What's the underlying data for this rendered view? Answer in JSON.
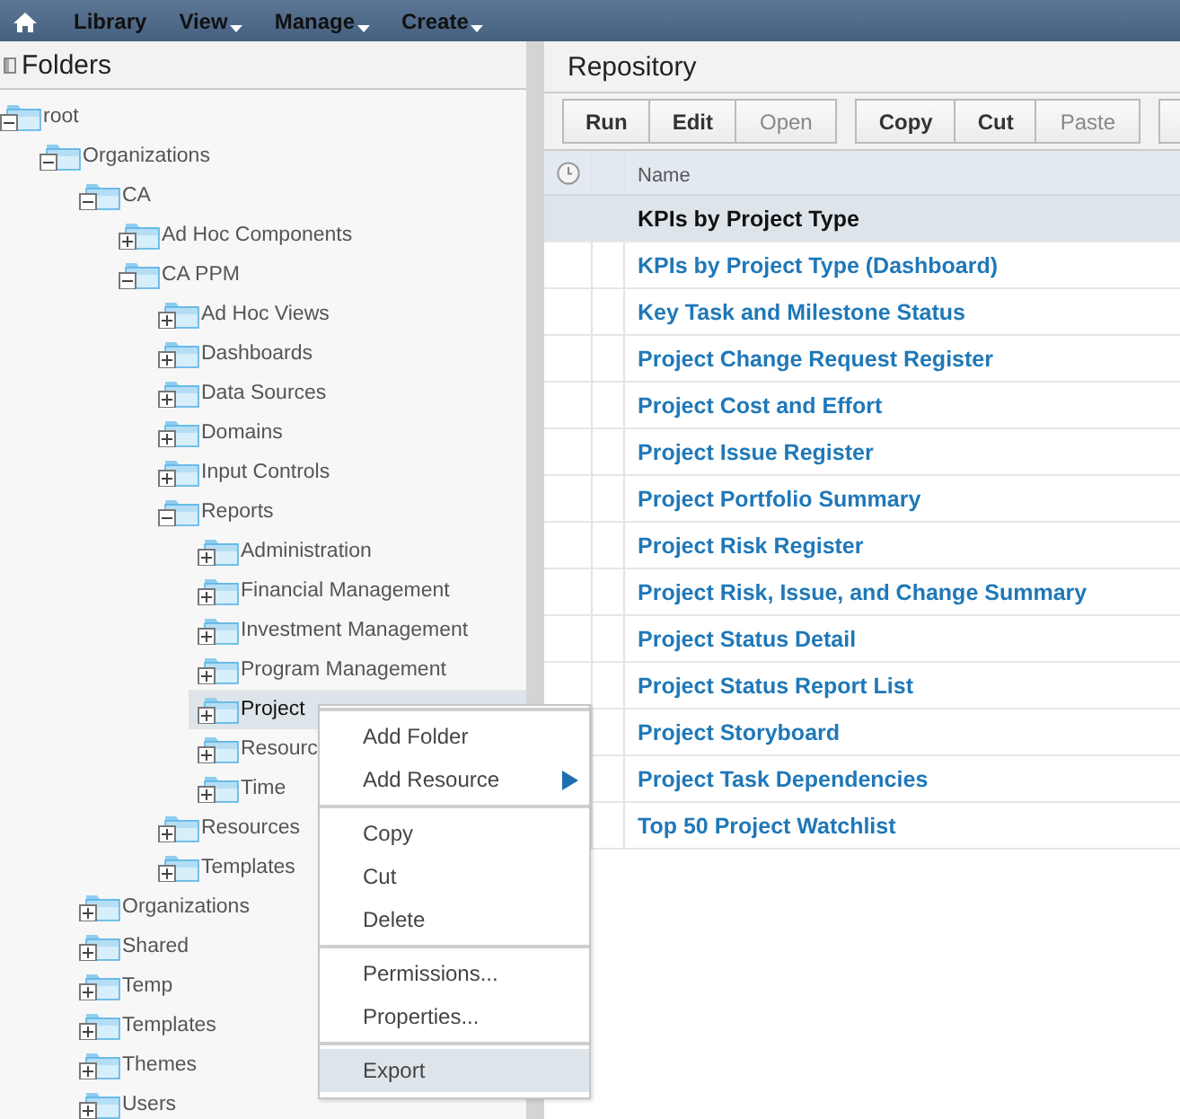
{
  "topbar": {
    "menus": [
      {
        "label": "Library",
        "has_menu": false
      },
      {
        "label": "View",
        "has_menu": true
      },
      {
        "label": "Manage",
        "has_menu": true
      },
      {
        "label": "Create",
        "has_menu": true
      }
    ]
  },
  "folders": {
    "title": "Folders",
    "tree": [
      {
        "label": "root",
        "expanded": true,
        "selected": false,
        "children": [
          {
            "label": "Organizations",
            "expanded": true,
            "selected": false,
            "children": [
              {
                "label": "CA",
                "expanded": true,
                "selected": false,
                "children": [
                  {
                    "label": "Ad Hoc Components",
                    "expanded": false,
                    "selected": false
                  },
                  {
                    "label": "CA PPM",
                    "expanded": true,
                    "selected": false,
                    "children": [
                      {
                        "label": "Ad Hoc Views",
                        "expanded": false,
                        "selected": false
                      },
                      {
                        "label": "Dashboards",
                        "expanded": false,
                        "selected": false
                      },
                      {
                        "label": "Data Sources",
                        "expanded": false,
                        "selected": false
                      },
                      {
                        "label": "Domains",
                        "expanded": false,
                        "selected": false
                      },
                      {
                        "label": "Input Controls",
                        "expanded": false,
                        "selected": false
                      },
                      {
                        "label": "Reports",
                        "expanded": true,
                        "selected": false,
                        "children": [
                          {
                            "label": "Administration",
                            "expanded": false,
                            "selected": false
                          },
                          {
                            "label": "Financial Management",
                            "expanded": false,
                            "selected": false
                          },
                          {
                            "label": "Investment Management",
                            "expanded": false,
                            "selected": false
                          },
                          {
                            "label": "Program Management",
                            "expanded": false,
                            "selected": false
                          },
                          {
                            "label": "Project",
                            "expanded": false,
                            "selected": true
                          },
                          {
                            "label": "Resourc",
                            "expanded": false,
                            "selected": false
                          },
                          {
                            "label": "Time",
                            "expanded": false,
                            "selected": false
                          }
                        ]
                      },
                      {
                        "label": "Resources",
                        "expanded": false,
                        "selected": false
                      },
                      {
                        "label": "Templates",
                        "expanded": false,
                        "selected": false
                      }
                    ]
                  }
                ]
              },
              {
                "label": "Organizations",
                "expanded": false,
                "selected": false
              },
              {
                "label": "Shared",
                "expanded": false,
                "selected": false
              },
              {
                "label": "Temp",
                "expanded": false,
                "selected": false
              },
              {
                "label": "Templates",
                "expanded": false,
                "selected": false
              },
              {
                "label": "Themes",
                "expanded": false,
                "selected": false
              },
              {
                "label": "Users",
                "expanded": false,
                "selected": false
              }
            ]
          }
        ]
      }
    ]
  },
  "repository": {
    "title": "Repository",
    "toolbar": [
      [
        {
          "label": "Run",
          "disabled": false
        },
        {
          "label": "Edit",
          "disabled": false
        },
        {
          "label": "Open",
          "disabled": true
        }
      ],
      [
        {
          "label": "Copy",
          "disabled": false
        },
        {
          "label": "Cut",
          "disabled": false
        },
        {
          "label": "Paste",
          "disabled": true
        }
      ]
    ],
    "column": "Name",
    "rows": [
      {
        "name": "KPIs by Project Type",
        "selected": true
      },
      {
        "name": "KPIs by Project Type (Dashboard)",
        "selected": false
      },
      {
        "name": "Key Task and Milestone Status",
        "selected": false
      },
      {
        "name": "Project Change Request Register",
        "selected": false
      },
      {
        "name": "Project Cost and Effort",
        "selected": false
      },
      {
        "name": "Project Issue Register",
        "selected": false
      },
      {
        "name": "Project Portfolio Summary",
        "selected": false
      },
      {
        "name": "Project Risk Register",
        "selected": false
      },
      {
        "name": "Project Risk, Issue, and Change Summary",
        "selected": false
      },
      {
        "name": "Project Status Detail",
        "selected": false
      },
      {
        "name": "Project Status Report List",
        "selected": false
      },
      {
        "name": "Project Storyboard",
        "selected": false
      },
      {
        "name": "Project Task Dependencies",
        "selected": false
      },
      {
        "name": "Top 50 Project Watchlist",
        "selected": false
      }
    ]
  },
  "context_menu": {
    "groups": [
      [
        {
          "label": "Add Folder",
          "kind": "item",
          "selected": false
        },
        {
          "label": "Add Resource",
          "kind": "submenu",
          "selected": false
        }
      ],
      [
        {
          "label": "Copy",
          "kind": "item",
          "selected": false
        },
        {
          "label": "Cut",
          "kind": "item",
          "selected": false
        },
        {
          "label": "Delete",
          "kind": "item",
          "selected": false
        }
      ],
      [
        {
          "label": "Permissions...",
          "kind": "item",
          "selected": false
        },
        {
          "label": "Properties...",
          "kind": "item",
          "selected": false
        }
      ],
      [
        {
          "label": "Export",
          "kind": "item",
          "selected": true
        }
      ]
    ]
  }
}
